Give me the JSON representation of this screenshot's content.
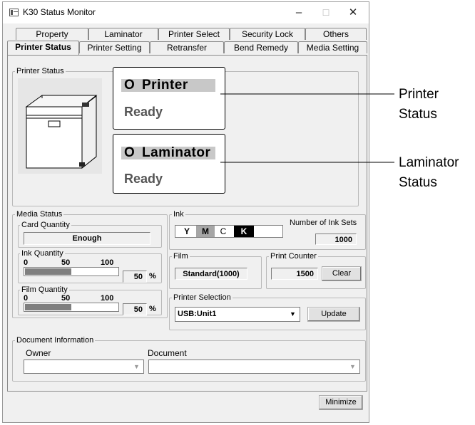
{
  "window": {
    "title": "K30 Status Monitor",
    "min_glyph": "–",
    "max_glyph": "☐",
    "close_glyph": "✕"
  },
  "tabs_row1": [
    "Property",
    "Laminator",
    "Printer Select",
    "Security Lock",
    "Others"
  ],
  "tabs_row2": [
    "Printer Status",
    "Printer Setting",
    "Retransfer",
    "Bend Remedy",
    "Media Setting"
  ],
  "printer_status": {
    "group_label": "Printer Status",
    "printer": {
      "indicator": "O",
      "name": "Printer",
      "state": "Ready"
    },
    "laminator": {
      "indicator": "O",
      "name": "Laminator",
      "state": "Ready"
    }
  },
  "media_status": {
    "group_label": "Media Status",
    "card_quantity": {
      "label": "Card Quantity",
      "value": "Enough"
    },
    "ink_quantity": {
      "label": "Ink Quantity",
      "scale": [
        "0",
        "50",
        "100"
      ],
      "value": "50",
      "unit": "%",
      "fill": 0.5
    },
    "film_quantity": {
      "label": "Film Quantity",
      "scale": [
        "0",
        "50",
        "100"
      ],
      "value": "50",
      "unit": "%",
      "fill": 0.5
    }
  },
  "ink": {
    "group_label": "Ink",
    "swatches": [
      {
        "letter": "Y",
        "bg": "#ffffff",
        "fg": "#000000"
      },
      {
        "letter": "M",
        "bg": "#a6a6a6",
        "fg": "#000000"
      },
      {
        "letter": "C",
        "bg": "#ffffff",
        "fg": "#000000"
      },
      {
        "letter": "K",
        "bg": "#000000",
        "fg": "#ffffff"
      }
    ],
    "sets_label": "Number of Ink Sets",
    "sets_value": "1000"
  },
  "film": {
    "group_label": "Film",
    "value": "Standard(1000)"
  },
  "print_counter": {
    "group_label": "Print Counter",
    "value": "1500",
    "clear_label": "Clear"
  },
  "printer_selection": {
    "group_label": "Printer Selection",
    "selected": "USB:Unit1",
    "update_label": "Update"
  },
  "document_info": {
    "group_label": "Document Information",
    "owner_label": "Owner",
    "document_label": "Document",
    "owner_value": "",
    "document_value": ""
  },
  "minimize_label": "Minimize",
  "annotations": {
    "printer_status": [
      "Printer",
      "Status"
    ],
    "laminator_status": [
      "Laminator",
      "Status"
    ]
  }
}
